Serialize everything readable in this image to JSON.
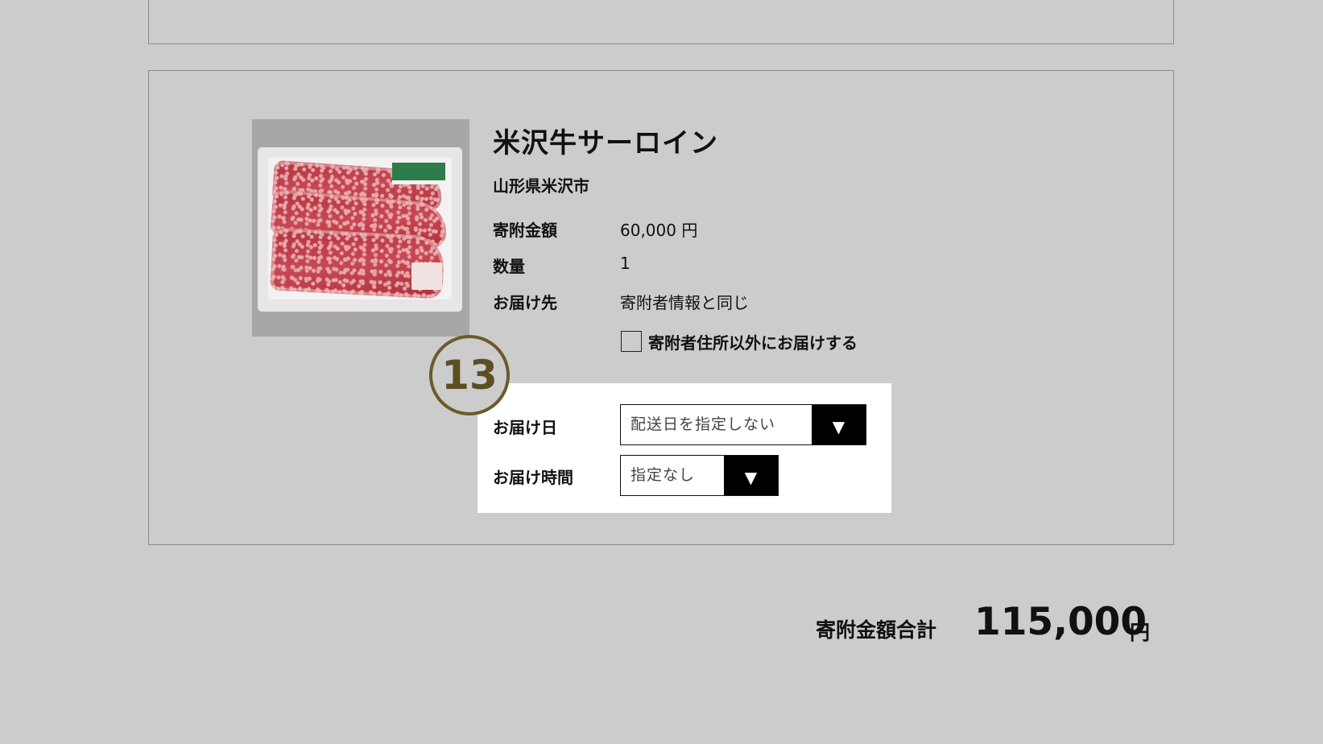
{
  "product": {
    "name": "米沢牛サーロイン",
    "municipality": "山形県米沢市",
    "image_alt": "米沢牛サーロイン",
    "donation_label": "寄附金額",
    "donation_value": "60,000 円",
    "quantity_label": "数量",
    "quantity_value": "1",
    "destination_label": "お届け先",
    "destination_value": "寄附者情報と同じ",
    "alt_address_label": "寄附者住所以外にお届けする",
    "alt_address_checked": false
  },
  "delivery": {
    "step_number": "13",
    "date_label": "お届け日",
    "date_selected": "配送日を指定しない",
    "time_label": "お届け時間",
    "time_selected": "指定なし",
    "dropdown_glyph": "▼"
  },
  "summary": {
    "total_label": "寄附金額合計",
    "total_value": "115,000",
    "total_unit": "円"
  },
  "colors": {
    "page_bg": "#cccccc",
    "border": "#8a8a8a",
    "highlight_bg": "#ffffff",
    "badge_color": "#6b5a2a",
    "dropdown_button": "#000000"
  }
}
